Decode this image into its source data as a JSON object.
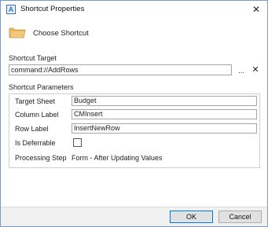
{
  "window": {
    "app_icon_letter": "A",
    "title": "Shortcut Properties",
    "close_glyph": "✕"
  },
  "header": {
    "icon": "folder-icon",
    "label": "Choose Shortcut"
  },
  "shortcut_target": {
    "label": "Shortcut Target",
    "value": "command://AddRows",
    "browse_label": "...",
    "clear_glyph": "✕"
  },
  "parameters": {
    "label": "Shortcut Parameters",
    "target_sheet": {
      "label": "Target Sheet",
      "value": "Budget"
    },
    "column_label": {
      "label": "Column Label",
      "value": "CMInsert"
    },
    "row_label": {
      "label": "Row Label",
      "value": "InsertNewRow"
    },
    "is_deferrable": {
      "label": "Is Deferrable",
      "checked": false
    },
    "processing_step": {
      "label": "Processing Step",
      "value": "Form - After Updating Values"
    }
  },
  "footer": {
    "ok_label": "OK",
    "cancel_label": "Cancel"
  },
  "colors": {
    "accent": "#0078d7",
    "folder": "#e8b964"
  }
}
